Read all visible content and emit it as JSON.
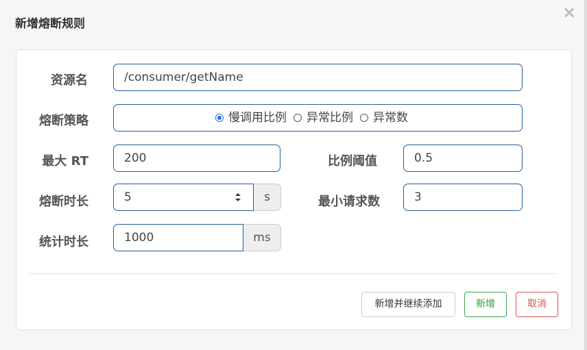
{
  "dialog": {
    "title": "新增熔断规则",
    "close_label": "×"
  },
  "form": {
    "resource": {
      "label": "资源名",
      "value": "/consumer/getName"
    },
    "strategy": {
      "label": "熔断策略",
      "options": [
        {
          "label": "慢调用比例",
          "checked": true
        },
        {
          "label": "异常比例",
          "checked": false
        },
        {
          "label": "异常数",
          "checked": false
        }
      ]
    },
    "max_rt": {
      "label": "最大 RT",
      "value": "200"
    },
    "ratio_threshold": {
      "label": "比例阈值",
      "value": "0.5"
    },
    "break_duration": {
      "label": "熔断时长",
      "value": "5",
      "unit": "s"
    },
    "min_requests": {
      "label": "最小请求数",
      "value": "3"
    },
    "stat_duration": {
      "label": "统计时长",
      "value": "1000",
      "unit": "ms"
    }
  },
  "buttons": {
    "add_continue": "新增并继续添加",
    "add": "新增",
    "cancel": "取消"
  },
  "colors": {
    "accent": "#1a73e8",
    "success": "#2e9e3e",
    "danger": "#d9534f"
  },
  "icons": [
    "close-icon",
    "stepper-icon"
  ]
}
